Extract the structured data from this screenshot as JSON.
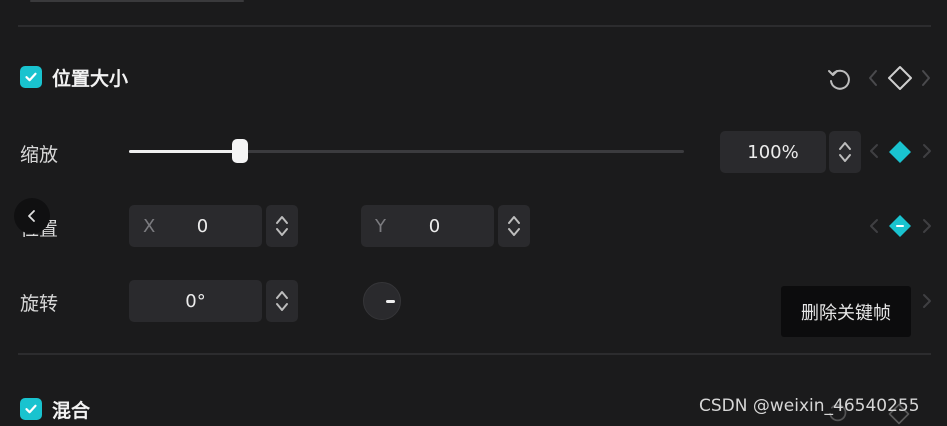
{
  "colors": {
    "accent": "#19c3cf",
    "background": "#1b1b1c",
    "field": "#2a2a2d"
  },
  "sections": {
    "transform": {
      "title": "位置大小",
      "checked": true
    },
    "blend": {
      "title": "混合",
      "checked": true
    }
  },
  "rows": {
    "scale": {
      "label": "缩放",
      "value": "100%",
      "slider_fraction": 0.2
    },
    "position": {
      "label": "位置",
      "x_axis": "X",
      "x_value": "0",
      "y_axis": "Y",
      "y_value": "0"
    },
    "rotation": {
      "label": "旋转",
      "value": "0°"
    }
  },
  "tooltip": {
    "text": "删除关键帧"
  },
  "watermark": {
    "text": "CSDN @weixin_46540255"
  },
  "icons": {
    "reset": "reset-icon",
    "keyframe_outline": "keyframe-diamond-outline-icon",
    "keyframe_filled": "keyframe-diamond-filled-icon",
    "prev": "chevron-left-icon",
    "next": "chevron-right-icon",
    "stepper": "stepper-arrows-icon"
  }
}
